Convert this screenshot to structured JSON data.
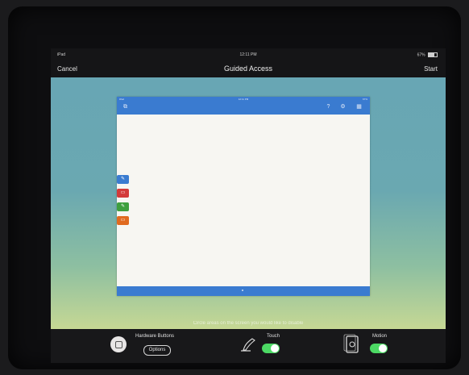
{
  "status_bar": {
    "device": "iPad",
    "wifi_icon": "wifi-icon",
    "time": "12:11 PM",
    "battery": "67%"
  },
  "nav": {
    "cancel": "Cancel",
    "title": "Guided Access",
    "start": "Start"
  },
  "app_preview": {
    "status_left": "iPad",
    "status_time": "12:11 PM",
    "status_right": "67%",
    "header_icons": [
      "share-icon",
      "help-icon",
      "gear-icon",
      "grid-icon"
    ],
    "tools": [
      {
        "name": "pen-tool",
        "color": "#3a7bd0",
        "glyph": "✎"
      },
      {
        "name": "comment-tool",
        "color": "#d33a3a",
        "glyph": "▭"
      },
      {
        "name": "highlight-tool",
        "color": "#3e9f3e",
        "glyph": "✎"
      },
      {
        "name": "note-tool",
        "color": "#e06a1f",
        "glyph": "▭"
      }
    ]
  },
  "hint": "Circle areas on the screen you would like to disable",
  "toolbar": {
    "hardware_label": "Hardware Buttons",
    "options_label": "Options",
    "touch_label": "Touch",
    "touch_on": true,
    "motion_label": "Motion",
    "motion_on": true
  },
  "colors": {
    "accent": "#3a7bd0",
    "switch_on": "#4cd964"
  }
}
